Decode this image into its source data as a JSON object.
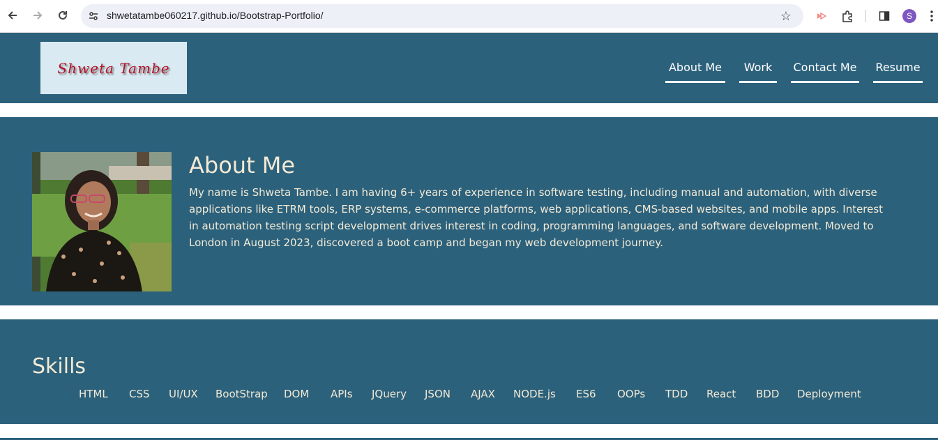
{
  "browser": {
    "url": "shwetatambe060217.github.io/Bootstrap-Portfolio/",
    "profile_initial": "S",
    "icons": [
      "back-arrow-icon",
      "forward-arrow-icon",
      "reload-icon",
      "site-info-icon",
      "bookmark-star-icon",
      "extension-icon",
      "puzzle-icon",
      "side-panel-icon",
      "kebab-menu-icon"
    ]
  },
  "header": {
    "logo_text": "Shweta Tambe",
    "nav": [
      "About Me",
      "Work",
      "Contact Me",
      "Resume"
    ]
  },
  "about": {
    "title": "About Me",
    "text": "My name is Shweta Tambe. I am having 6+ years of experience in software testing, including manual and automation, with diverse applications like ETRM tools, ERP systems, e-commerce platforms, web applications, CMS-based websites, and mobile apps. Interest in automation testing script development drives interest in coding, programming languages, and software development. Moved to London in August 2023, discovered a boot camp and began my web development journey."
  },
  "skills": {
    "title": "Skills",
    "items": [
      "HTML",
      "CSS",
      "UI/UX",
      "BootStrap",
      "DOM",
      "APIs",
      "JQuery",
      "JSON",
      "AJAX",
      "NODE.js",
      "ES6",
      "OOPs",
      "TDD",
      "React",
      "BDD",
      "Deployment"
    ]
  },
  "colors": {
    "section_bg": "#2c617c",
    "text": "#f2ead5",
    "logo_bg": "#daeaf2",
    "logo_text": "#b3122a"
  }
}
